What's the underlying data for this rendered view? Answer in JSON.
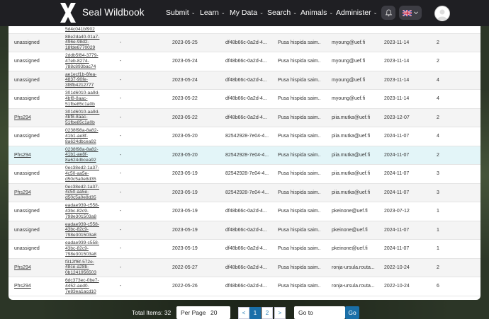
{
  "app": {
    "brand": "Seal Wildbook",
    "menu": [
      {
        "label": "Submit",
        "name": "nav-submit"
      },
      {
        "label": "Learn",
        "name": "nav-learn"
      },
      {
        "label": "My Data",
        "name": "nav-my-data"
      },
      {
        "label": "Search",
        "name": "nav-search"
      },
      {
        "label": "Animals",
        "name": "nav-animals"
      },
      {
        "label": "Administer",
        "name": "nav-administer"
      }
    ],
    "icons": {
      "notification": "bell-icon",
      "language": "uk-flag-icon",
      "profile": "avatar"
    }
  },
  "table": {
    "rows": [
      {
        "assign": "unassigned",
        "link": false,
        "id": [
          "f8c6d9cc-e997-",
          "4cc4-9a68-",
          "5d4c041bf902"
        ],
        "dash": "-",
        "date": "2023-05-27",
        "uuid": "df48b66c-0a2d-4...",
        "species": "Pusa hispida saim...",
        "user": "myoung@uef.fi",
        "modified": "2023-11-14",
        "count": "2"
      },
      {
        "assign": "unassigned",
        "link": false,
        "id": [
          "88e2da40-01a7-",
          "496e-98d2-",
          "18fde6770029"
        ],
        "dash": "-",
        "date": "2023-05-25",
        "uuid": "df48b66c-0a2d-4...",
        "species": "Pusa hispida saim...",
        "user": "myoung@uef.fi",
        "modified": "2023-11-14",
        "count": "2"
      },
      {
        "assign": "unassigned",
        "link": false,
        "id": [
          "2ddb5f84-3779-",
          "47eb-8274-",
          "788c893bac74"
        ],
        "dash": "-",
        "date": "2023-05-24",
        "uuid": "df48b66c-0a2d-4...",
        "species": "Pusa hispida saim...",
        "user": "myoung@uef.fi",
        "modified": "2023-11-14",
        "count": "2"
      },
      {
        "assign": "unassigned",
        "link": false,
        "id": [
          "ae1ecf1b-6fea-",
          "4837-90fe-",
          "3f8fb4212777"
        ],
        "dash": "-",
        "date": "2023-05-24",
        "uuid": "df48b66c-0a2d-4...",
        "species": "Pusa hispida saim...",
        "user": "myoung@uef.fi",
        "modified": "2023-11-14",
        "count": "4"
      },
      {
        "assign": "unassigned",
        "link": false,
        "id": [
          "301d6010-aa9d-",
          "4bf8-8aac-",
          "51fbe85c1a0b"
        ],
        "dash": "-",
        "date": "2023-05-22",
        "uuid": "df48b66c-0a2d-4...",
        "species": "Pusa hispida saim...",
        "user": "myoung@uef.fi",
        "modified": "2023-11-14",
        "count": "4"
      },
      {
        "assign": "Phs294",
        "link": true,
        "id": [
          "301d6010-aa9d-",
          "4bf8-8aac-",
          "51fbe85c1a0b"
        ],
        "dash": "-",
        "date": "2023-05-22",
        "uuid": "df48b66c-0a2d-4...",
        "species": "Pusa hispida saim...",
        "user": "piia.mutka@uef.fi",
        "modified": "2023-12-07",
        "count": "2"
      },
      {
        "assign": "unassigned",
        "link": false,
        "id": [
          "0238f98a-8a82-",
          "41b1-ae8f-",
          "8a624dbcea92"
        ],
        "dash": "-",
        "date": "2023-05-20",
        "uuid": "82542928-7e04-4...",
        "species": "Pusa hispida saim...",
        "user": "piia.mutka@uef.fi",
        "modified": "2024-11-07",
        "count": "4"
      },
      {
        "assign": "Phs294",
        "link": true,
        "id": [
          "0238f98a-8a82-",
          "41b1-ae8f-",
          "8a624dbcea92"
        ],
        "dash": "-",
        "date": "2023-05-20",
        "uuid": "82542928-7e04-4...",
        "species": "Pusa hispida saim...",
        "user": "piia.mutka@uef.fi",
        "modified": "2024-11-07",
        "count": "2"
      },
      {
        "assign": "unassigned",
        "link": false,
        "id": [
          "0ec38ed2-1a37-",
          "4c50-aa5e-",
          "d50c5a0e8d35"
        ],
        "dash": "-",
        "date": "2023-05-19",
        "uuid": "82542928-7e04-4...",
        "species": "Pusa hispida saim...",
        "user": "piia.mutka@uef.fi",
        "modified": "2024-11-07",
        "count": "3"
      },
      {
        "assign": "Phs294",
        "link": true,
        "id": [
          "0ec38ed2-1a37-",
          "4c50-aa5e-",
          "d50c5a0e8d35"
        ],
        "dash": "-",
        "date": "2023-05-19",
        "uuid": "82542928-7e04-4...",
        "species": "Pusa hispida saim...",
        "user": "piia.mutka@uef.fi",
        "modified": "2024-11-07",
        "count": "3"
      },
      {
        "assign": "unassigned",
        "link": false,
        "id": [
          "eadae939-c558-",
          "43bc-82c9-",
          "798e301503a8"
        ],
        "dash": "-",
        "date": "2023-05-19",
        "uuid": "df48b66c-0a2d-4...",
        "species": "Pusa hispida saim...",
        "user": "pkeinone@uef.fi",
        "modified": "2023-07-12",
        "count": "1"
      },
      {
        "assign": "unassigned",
        "link": false,
        "id": [
          "eadae939-c558-",
          "43bc-82c9-",
          "798e301503a8"
        ],
        "dash": "-",
        "date": "2023-05-19",
        "uuid": "df48b66c-0a2d-4...",
        "species": "Pusa hispida saim...",
        "user": "pkeinone@uef.fi",
        "modified": "2024-11-07",
        "count": "1"
      },
      {
        "assign": "unassigned",
        "link": false,
        "id": [
          "eadae939-c558-",
          "43bc-82c9-",
          "798e301503a8"
        ],
        "dash": "-",
        "date": "2023-05-19",
        "uuid": "df48b66c-0a2d-4...",
        "species": "Pusa hispida saim...",
        "user": "pkeinone@uef.fi",
        "modified": "2024-11-07",
        "count": "1"
      },
      {
        "assign": "Phs294",
        "link": true,
        "id": [
          "f312ff6f-572e-",
          "48ce-a28b-",
          "0b1241956503"
        ],
        "dash": "-",
        "date": "2022-05-27",
        "uuid": "df48b66c-0a2d-4...",
        "species": "Pusa hispida saim...",
        "user": "ronja-ursula.routa...",
        "modified": "2022-10-24",
        "count": "2"
      },
      {
        "assign": "Phs294",
        "link": true,
        "id": [
          "6dc373ec-0be7-",
          "4452-aed0-",
          "7e83ea1acd10"
        ],
        "dash": "-",
        "date": "2022-05-26",
        "uuid": "df48b66c-0a2d-4...",
        "species": "Pusa hispida saim...",
        "user": "ronja-ursula.routa...",
        "modified": "2022-10-24",
        "count": "6"
      }
    ],
    "highlighted_row": 7
  },
  "footer": {
    "total": "Total Items: 32",
    "per_page_label": "Per Page",
    "per_page_value": "20",
    "prev": "<",
    "pages": [
      "1",
      "2"
    ],
    "next": ">",
    "goto_label": "Go to",
    "go_button": "Go"
  }
}
